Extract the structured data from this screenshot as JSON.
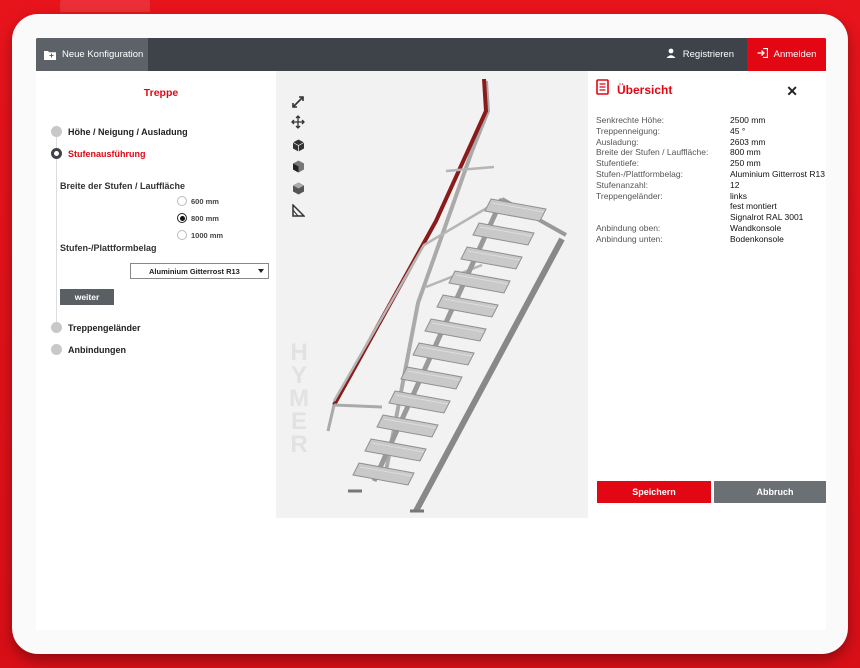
{
  "header": {
    "new_config": "Neue Konfiguration",
    "register": "Registrieren",
    "login": "Anmelden"
  },
  "left": {
    "title": "Treppe",
    "steps": [
      {
        "label": "Höhe / Neigung / Ausladung",
        "active": false
      },
      {
        "label": "Stufenausführung",
        "active": true
      },
      {
        "label": "Treppengeländer",
        "active": false
      },
      {
        "label": "Anbindungen",
        "active": false
      }
    ],
    "width_label": "Breite der Stufen / Lauffläche",
    "width_options": [
      {
        "label": "600 mm",
        "selected": false
      },
      {
        "label": "800 mm",
        "selected": true
      },
      {
        "label": "1000 mm",
        "selected": false
      }
    ],
    "covering_label": "Stufen-/Plattformbelag",
    "covering_value": "Aluminium Gitterrost R13",
    "next_button": "weiter"
  },
  "viewer": {
    "watermark": "HYMER",
    "tools": [
      "expand-icon",
      "move-icon",
      "cube-solid-icon",
      "cube-side-icon",
      "cube-top-icon",
      "measure-icon"
    ]
  },
  "summary": {
    "title": "Übersicht",
    "close": "✕",
    "rows": [
      {
        "key": "Senkrechte Höhe:",
        "value": "2500 mm"
      },
      {
        "key": "Treppenneigung:",
        "value": "45 °"
      },
      {
        "key": "Ausladung:",
        "value": "2603 mm"
      },
      {
        "key": "Breite der Stufen / Lauffläche:",
        "value": "800 mm"
      },
      {
        "key": "Stufentiefe:",
        "value": "250 mm"
      },
      {
        "key": "Stufen-/Plattformbelag:",
        "value": "Aluminium Gitterrost R13"
      },
      {
        "key": "Stufenanzahl:",
        "value": "12"
      },
      {
        "key": "Treppengeländer:",
        "value": "links"
      },
      {
        "key": "",
        "value": "fest montiert"
      },
      {
        "key": "",
        "value": "Signalrot RAL 3001"
      },
      {
        "key": "Anbindung oben:",
        "value": "Wandkonsole"
      },
      {
        "key": "Anbindung unten:",
        "value": "Bodenkonsole"
      }
    ],
    "save": "Speichern",
    "cancel": "Abbruch"
  },
  "colors": {
    "brand_red": "#e30613",
    "topbar": "#3d4349",
    "railing": "#8b1a1a"
  }
}
